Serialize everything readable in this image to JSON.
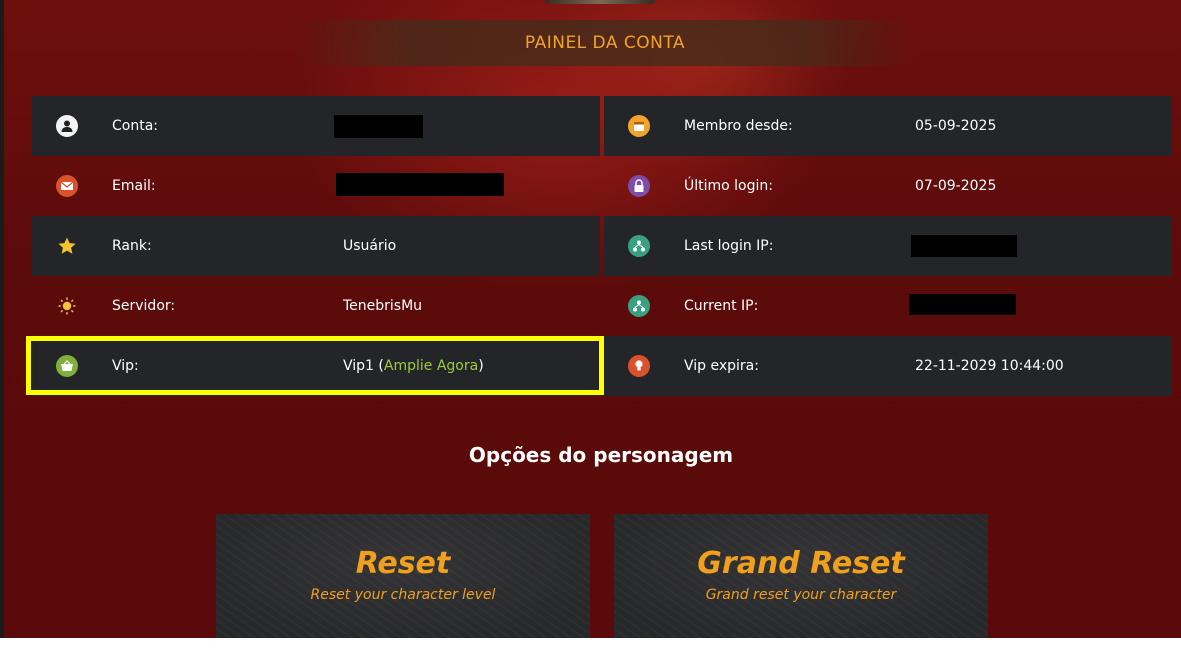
{
  "panel": {
    "title": "PAINEL DA CONTA"
  },
  "account_left": [
    {
      "icon": "user-icon",
      "label": "Conta:",
      "value": ""
    },
    {
      "icon": "mail-icon",
      "label": "Email:",
      "value": ""
    },
    {
      "icon": "star-icon",
      "label": "Rank:",
      "value": "Usuário"
    },
    {
      "icon": "sun-icon",
      "label": "Servidor:",
      "value": "TenebrisMu"
    },
    {
      "icon": "basket-icon",
      "label": "Vip:",
      "value_prefix": "Vip1 (",
      "link": "Amplie Agora",
      "value_suffix": ")"
    }
  ],
  "account_right": [
    {
      "icon": "calendar-icon",
      "label": "Membro desde:",
      "value": "05-09-2025"
    },
    {
      "icon": "lock-icon",
      "label": "Último login:",
      "value": "07-09-2025"
    },
    {
      "icon": "network-icon",
      "label": "Last login IP:",
      "value": ""
    },
    {
      "icon": "network-icon",
      "label": "Current IP:",
      "value": ""
    },
    {
      "icon": "lightbulb-icon",
      "label": "Vip expira:",
      "value": "22-11-2029 10:44:00"
    }
  ],
  "section": {
    "title": "Opções do personagem"
  },
  "cards": [
    {
      "title": "Reset",
      "subtitle": "Reset your character level"
    },
    {
      "title": "Grand Reset",
      "subtitle": "Grand reset your character"
    }
  ],
  "colors": {
    "accent": "#f0a01c",
    "vip_link": "#9ccc3a",
    "highlight": "#ffff00",
    "row_dark": "#232529"
  }
}
